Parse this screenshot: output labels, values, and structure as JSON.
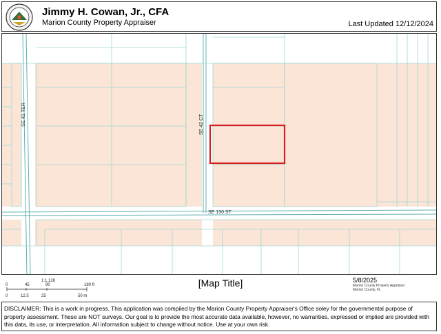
{
  "header": {
    "title": "Jimmy H. Cowan, Jr., CFA",
    "subtitle": "Marion County Property Appraiser",
    "last_updated": "Last Updated 12/12/2024",
    "seal_text": "PROPERTY APPRAISER"
  },
  "map": {
    "roads": {
      "se_41_ter": "SE 41 TER",
      "se_42_ct": "SE 42 CT",
      "se_130_st": "SE 130 ST"
    },
    "colors": {
      "parcel_fill": "#fbe5d6",
      "parcel_line": "#9fd8d8",
      "road_line": "#5fb0b0",
      "selection": "#d91e1e"
    }
  },
  "scale": {
    "ratio": "1:1,128",
    "ft_ticks": [
      "0",
      "45",
      "90",
      "180 ft"
    ],
    "m_ticks": [
      "0",
      "12.5",
      "25",
      "50 m"
    ]
  },
  "map_title": "[Map Title]",
  "footer": {
    "date": "5/8/2025",
    "credit_line1": "Marion County Property Appraiser",
    "credit_line2": "Marion County, FL"
  },
  "disclaimer": "DISCLAIMER: This is a work in progress. This application was compiled by the Marion County Property Appraiser's Office soley for the governmental purpose of property assessment. These are NOT surveys. Our goal is to provide the most accurate data available, however, no warranties, expressed or implied are provided with this data, its use, or interpretation. All information subject to change without notice. Use at your own risk."
}
